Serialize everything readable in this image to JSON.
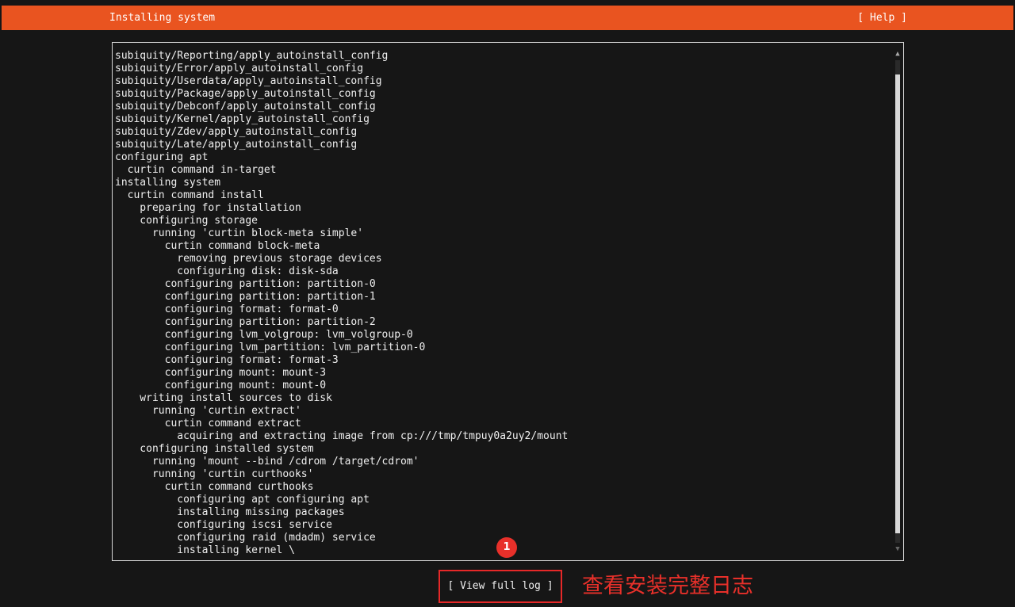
{
  "header": {
    "title": "Installing system",
    "help_label": "[ Help ]"
  },
  "log": {
    "lines": [
      "subiquity/Reporting/apply_autoinstall_config",
      "subiquity/Error/apply_autoinstall_config",
      "subiquity/Userdata/apply_autoinstall_config",
      "subiquity/Package/apply_autoinstall_config",
      "subiquity/Debconf/apply_autoinstall_config",
      "subiquity/Kernel/apply_autoinstall_config",
      "subiquity/Zdev/apply_autoinstall_config",
      "subiquity/Late/apply_autoinstall_config",
      "configuring apt",
      "  curtin command in-target",
      "installing system",
      "  curtin command install",
      "    preparing for installation",
      "    configuring storage",
      "      running 'curtin block-meta simple'",
      "        curtin command block-meta",
      "          removing previous storage devices",
      "          configuring disk: disk-sda",
      "        configuring partition: partition-0",
      "        configuring partition: partition-1",
      "        configuring format: format-0",
      "        configuring partition: partition-2",
      "        configuring lvm_volgroup: lvm_volgroup-0",
      "        configuring lvm_partition: lvm_partition-0",
      "        configuring format: format-3",
      "        configuring mount: mount-3",
      "        configuring mount: mount-0",
      "    writing install sources to disk",
      "      running 'curtin extract'",
      "        curtin command extract",
      "          acquiring and extracting image from cp:///tmp/tmpuy0a2uy2/mount",
      "    configuring installed system",
      "      running 'mount --bind /cdrom /target/cdrom'",
      "      running 'curtin curthooks'",
      "        curtin command curthooks",
      "          configuring apt configuring apt",
      "          installing missing packages",
      "          configuring iscsi service",
      "          configuring raid (mdadm) service",
      "          installing kernel \\"
    ]
  },
  "scrollbar": {
    "up_arrow": "▲",
    "down_arrow": "▼"
  },
  "actions": {
    "view_full_log_label": "[ View full log ]"
  },
  "annotation": {
    "marker_number": "1",
    "text": "查看安装完整日志",
    "color": "#e8302a"
  },
  "colors": {
    "header_bg": "#e95420",
    "background": "#161616",
    "text": "#efefef"
  }
}
